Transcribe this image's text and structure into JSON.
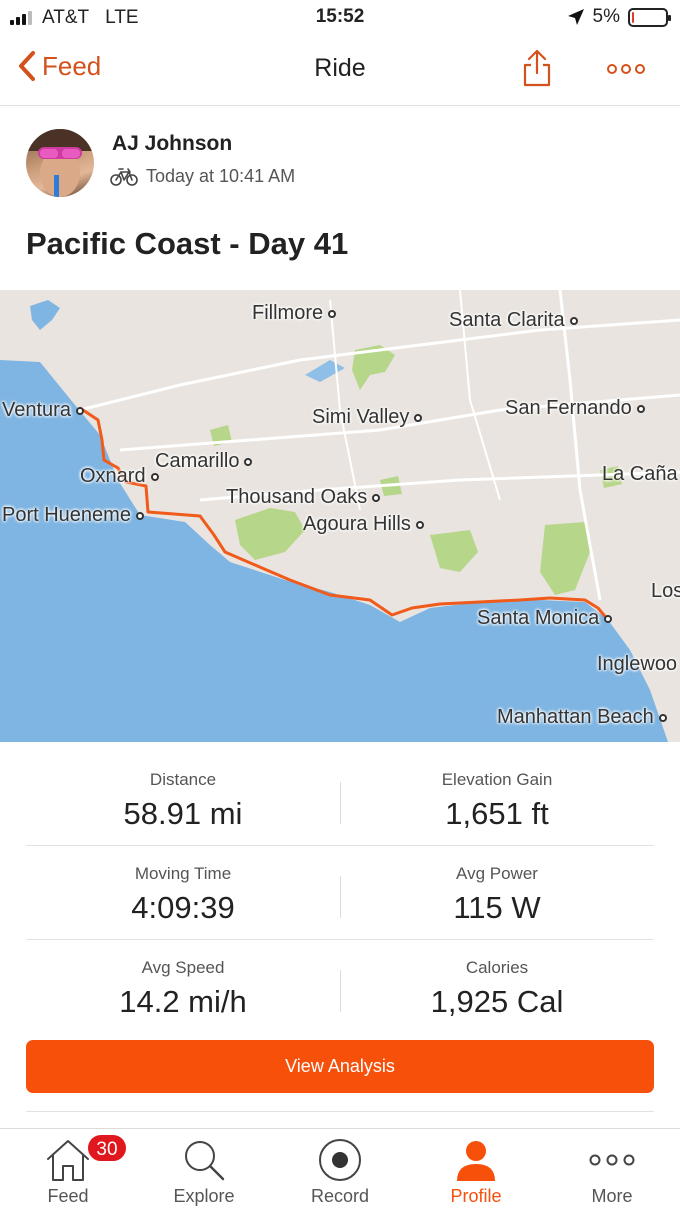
{
  "status_bar": {
    "carrier": "AT&T",
    "network": "LTE",
    "time": "15:52",
    "battery_percent": "5%",
    "battery_level": 0.05
  },
  "nav": {
    "back_label": "Feed",
    "title": "Ride",
    "share_icon": "share-icon",
    "more_icon": "more-dots-icon"
  },
  "athlete": {
    "name": "AJ Johnson",
    "timestamp": "Today at 10:41 AM",
    "activity_icon": "bike-icon"
  },
  "activity": {
    "title": "Pacific Coast - Day 41"
  },
  "map": {
    "places": [
      "Fillmore",
      "Santa Clarita",
      "Ventura",
      "Simi Valley",
      "San Fernando",
      "Camarillo",
      "Oxnard",
      "La Caña",
      "Thousand Oaks",
      "Port Hueneme",
      "Agoura Hills",
      "Los",
      "Santa Monica",
      "Inglewoo",
      "Manhattan Beach"
    ],
    "route_color": "#f05a1a",
    "water_color": "#7fb5e2",
    "land_color": "#e9e4df",
    "park_color": "#b6d68a"
  },
  "stats": {
    "distance": {
      "label": "Distance",
      "value": "58.91 mi"
    },
    "elevation": {
      "label": "Elevation Gain",
      "value": "1,651 ft"
    },
    "moving_time": {
      "label": "Moving Time",
      "value": "4:09:39"
    },
    "avg_power": {
      "label": "Avg Power",
      "value": "115 W"
    },
    "avg_speed": {
      "label": "Avg Speed",
      "value": "14.2 mi/h"
    },
    "calories": {
      "label": "Calories",
      "value": "1,925 Cal"
    }
  },
  "view_analysis_label": "View Analysis",
  "accent_color": "#f6500b",
  "tabbar": {
    "feed": {
      "label": "Feed",
      "badge": "30",
      "icon": "home-icon"
    },
    "explore": {
      "label": "Explore",
      "icon": "search-icon"
    },
    "record": {
      "label": "Record",
      "icon": "record-icon"
    },
    "profile": {
      "label": "Profile",
      "icon": "profile-icon"
    },
    "more": {
      "label": "More",
      "icon": "more-dots-icon"
    }
  }
}
